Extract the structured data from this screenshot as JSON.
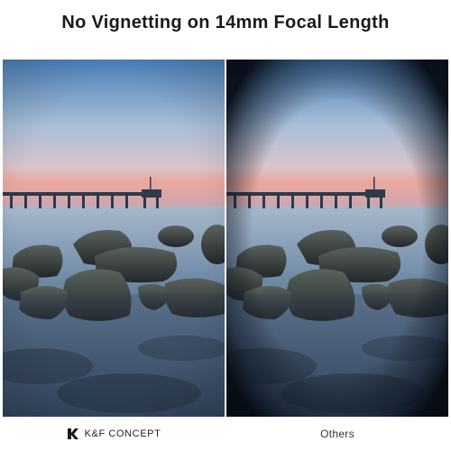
{
  "title": "No Vignetting on 14mm Focal Length",
  "panels": {
    "left": {
      "vignette": false
    },
    "right": {
      "vignette": true
    }
  },
  "captions": {
    "left_brand": "K&F CONCEPT",
    "right_label": "Others"
  },
  "icons": {
    "brand_logo": "kf-logo-icon"
  },
  "colors": {
    "sky_top": "#4a7fb8",
    "sky_mid": "#b7c9dc",
    "horizon_glow": "#e9a79b",
    "water": "#4f6e8c",
    "rock": "#3a3f3c"
  }
}
